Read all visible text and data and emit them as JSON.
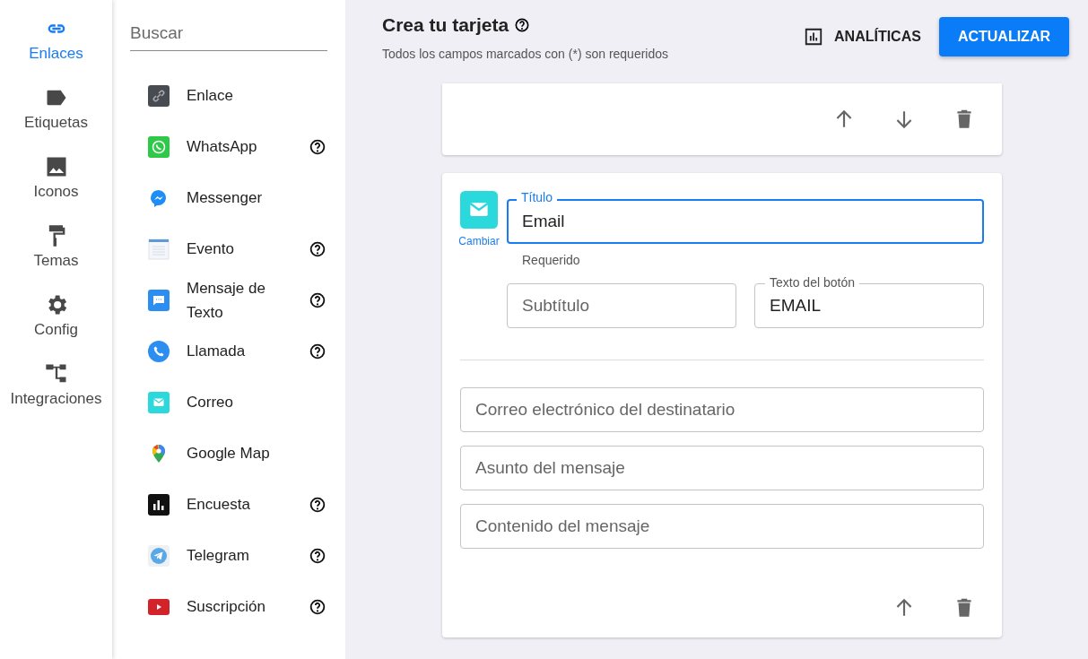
{
  "nav": [
    {
      "label": "Enlaces",
      "kind": "link",
      "selected": true
    },
    {
      "label": "Etiquetas",
      "kind": "tag",
      "selected": false
    },
    {
      "label": "Iconos",
      "kind": "image",
      "selected": false
    },
    {
      "label": "Temas",
      "kind": "roller",
      "selected": false
    },
    {
      "label": "Config",
      "kind": "gear",
      "selected": false
    },
    {
      "label": "Integraciones",
      "kind": "tree",
      "selected": false
    }
  ],
  "search": {
    "placeholder": "Buscar"
  },
  "link_types": [
    {
      "label": "Enlace",
      "kind": "link",
      "help": false
    },
    {
      "label": "WhatsApp",
      "kind": "whatsapp",
      "help": true
    },
    {
      "label": "Messenger",
      "kind": "messenger",
      "help": false
    },
    {
      "label": "Evento",
      "kind": "calendar",
      "help": true
    },
    {
      "label": "Mensaje de Texto",
      "kind": "sms",
      "help": true
    },
    {
      "label": "Llamada",
      "kind": "phone",
      "help": true
    },
    {
      "label": "Correo",
      "kind": "mail",
      "help": false
    },
    {
      "label": "Google Map",
      "kind": "pin",
      "help": false
    },
    {
      "label": "Encuesta",
      "kind": "poll",
      "help": true
    },
    {
      "label": "Telegram",
      "kind": "plane",
      "help": true
    },
    {
      "label": "Suscripción",
      "kind": "play",
      "help": true
    }
  ],
  "header": {
    "title": "Crea tu tarjeta",
    "subtitle": "Todos los campos marcados con (*) son requeridos",
    "buttons": [
      {
        "label": "ANALÍTICAS",
        "kind": "text"
      },
      {
        "label": "ACTUALIZAR",
        "kind": "primary"
      }
    ]
  },
  "cards": [
    {
      "actions": [
        {
          "kind": "up"
        },
        {
          "kind": "down"
        },
        {
          "kind": "delete"
        }
      ]
    },
    {
      "icon_caption": "Cambiar",
      "title_field": {
        "label": "Título",
        "value": "Email",
        "focused": true,
        "helper": "Requerido"
      },
      "subtitle_field": {
        "placeholder": "Subtítulo"
      },
      "button_text_field": {
        "label": "Texto del botón",
        "value": "EMAIL"
      },
      "extra_fields": [
        {
          "placeholder": "Correo electrónico del destinatario"
        },
        {
          "placeholder": "Asunto del mensaje"
        },
        {
          "placeholder": "Contenido del mensaje"
        }
      ],
      "actions": [
        {
          "kind": "up"
        },
        {
          "kind": "delete"
        }
      ]
    }
  ]
}
